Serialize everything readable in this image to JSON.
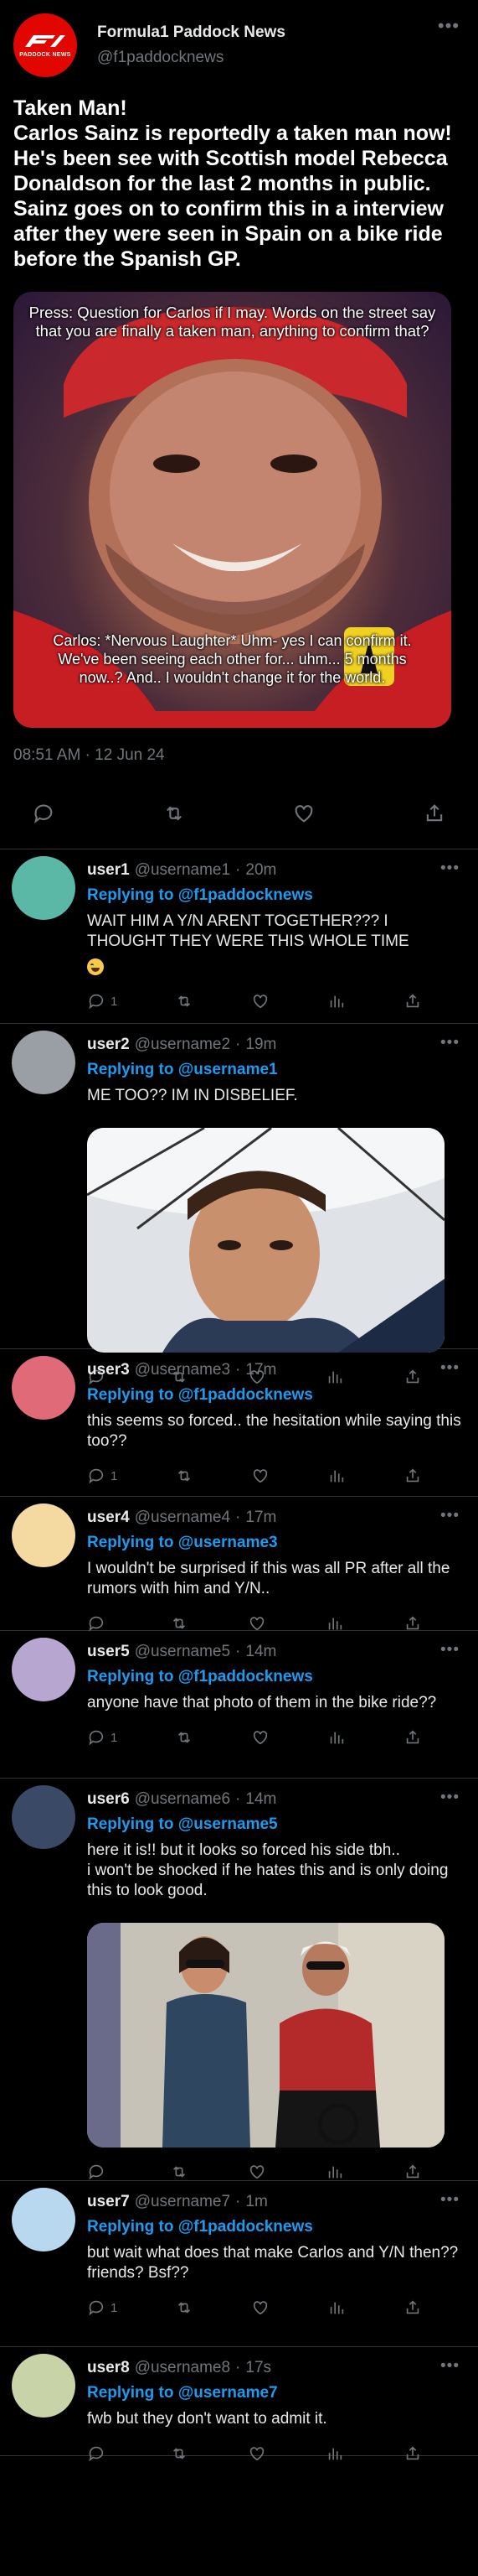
{
  "main_tweet": {
    "display_name": "Formula1 Paddock News",
    "handle": "@f1paddocknews",
    "logo_text": "PADDOCK NEWS",
    "text": "Taken Man!\nCarlos Sainz is reportedly a taken man now! He's been see with Scottish model Rebecca Donaldson for the last 2 months in public.\nSainz goes on to confirm this in a interview after they were seen in Spain on a bike ride before the Spanish GP.",
    "media": {
      "caption_top": "Press: Question for Carlos if I may. Words on the street say that you are finally a taken man, anything to confirm that?",
      "caption_bottom": "Carlos: *Nervous Laughter* Uhm- yes I can confirm it. We've been seeing each other for... uhm... 5 months now..? And.. I wouldn't change it for the world."
    },
    "timestamp": "08:51 AM · 12 Jun 24",
    "actions": [
      "reply-icon",
      "retweet-icon",
      "like-icon",
      "share-icon"
    ]
  },
  "replies": [
    {
      "user": "user1",
      "handle": "@username1",
      "time": "20m",
      "replying_to": "@f1paddocknews",
      "text": "WAIT HIM A Y/N ARENT TOGETHER??? I THOUGHT THEY WERE THIS WHOLE TIME",
      "emoji": "laughing-emoji",
      "reply_count": "1",
      "avatar_color": "#5bb8a6"
    },
    {
      "user": "user2",
      "handle": "@username2",
      "time": "19m",
      "replying_to": "@username1",
      "text": "ME TOO?? IM IN DISBELIEF.",
      "reply_count": "",
      "avatar_color": "#9a9fa5",
      "has_media": true
    },
    {
      "user": "user3",
      "handle": "@username3",
      "time": "17m",
      "replying_to": "@f1paddocknews",
      "text": "this seems so forced.. the hesitation while saying this too??",
      "reply_count": "1",
      "avatar_color": "#e06a78"
    },
    {
      "user": "user4",
      "handle": "@username4",
      "time": "17m",
      "replying_to": "@username3",
      "text": "I wouldn't be surprised if this was all PR after all the rumors with him and Y/N..",
      "reply_count": "",
      "avatar_color": "#f4d9a0"
    },
    {
      "user": "user5",
      "handle": "@username5",
      "time": "14m",
      "replying_to": "@f1paddocknews",
      "text": "anyone have that photo of them in the bike ride??",
      "reply_count": "1",
      "avatar_color": "#b7a6d0"
    },
    {
      "user": "user6",
      "handle": "@username6",
      "time": "14m",
      "replying_to": "@username5",
      "text": "here it is!! but it looks so forced his side tbh..\ni won't be shocked if he hates this and is only doing this to look good.",
      "reply_count": "",
      "avatar_color": "#3a4a66",
      "has_media": true
    },
    {
      "user": "user7",
      "handle": "@username7",
      "time": "1m",
      "replying_to": "@f1paddocknews",
      "text": "but wait what does that make Carlos and Y/N then?? friends? Bsf??",
      "reply_count": "1",
      "avatar_color": "#b8d8f0"
    },
    {
      "user": "user8",
      "handle": "@username8",
      "time": "17s",
      "replying_to": "@username7",
      "text": "fwb but they don't want to admit it.",
      "reply_count": "",
      "avatar_color": "#c8d4a8"
    }
  ],
  "labels": {
    "replying_to": "Replying to",
    "separator": "·"
  },
  "colors": {
    "background": "#000000",
    "link": "#1d9bf0",
    "muted": "#71767b",
    "f1_red": "#e10600"
  }
}
